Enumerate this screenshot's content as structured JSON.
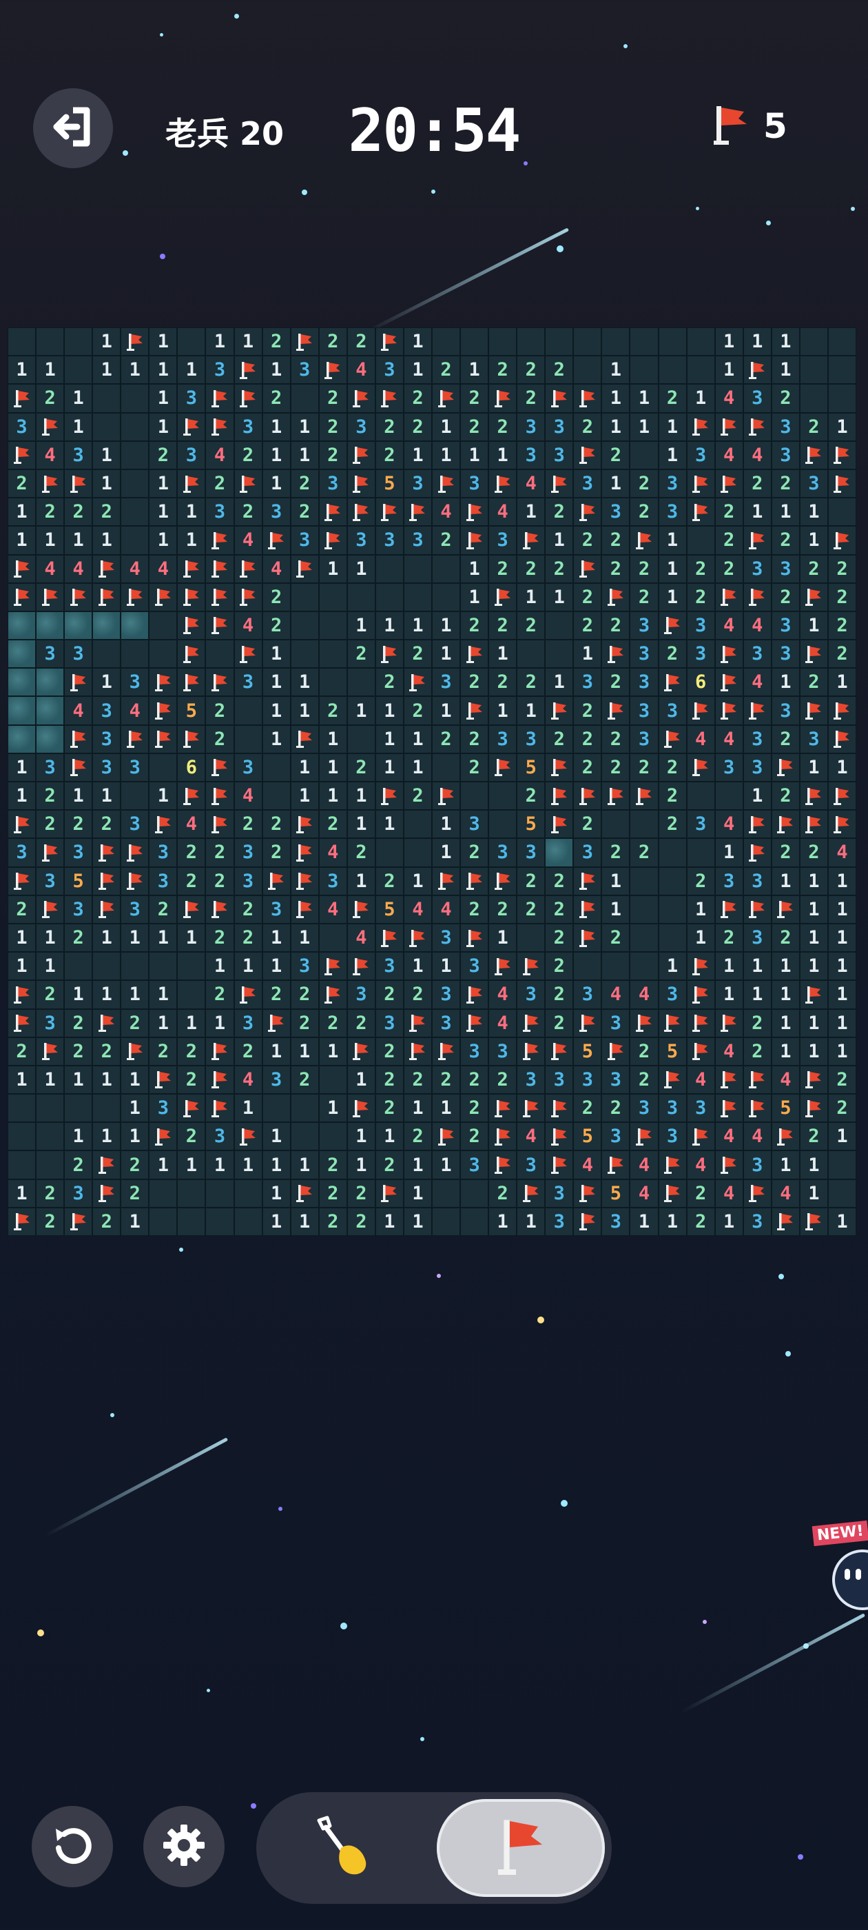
{
  "header": {
    "level_label": "老兵 20",
    "timer": "20:54",
    "flags_remaining": "5",
    "exit_icon": "exit-icon",
    "flag_icon": "flag-icon"
  },
  "board": {
    "columns": 30,
    "rows": 32,
    "legend": {
      "F": "flag",
      "X": "unrevealed",
      ".": "empty",
      "1-6": "adjacent mine count"
    },
    "cells": [
      "...1F1.112F22F1..........111..",
      "11.11113F13F43121222.1...1F1..",
      "F21..13FF2.2FF2F2F2FF1121432..",
      "3F1..1FF3112322122332111FFF321",
      "F431.2342112F2111133F2.13443FF1",
      "2FF1.1F2F123F53F3F4F3123FF223FF21",
      "1222.113232FFFF4F412F323F2111",
      "1111.11F4F3F3332F3F122F1.2F21F1",
      "F44F44FFF4F11...1222F2212233221",
      "FFFFFFFFF2......1F112F212FF2F211",
      "XXXXX.FF42..1111222.223F3443122",
      "X33...F.F1..2F21F1..1F323F33F2F1",
      "XXF13FFF311..2F32221323F6F4121",
      "XX434F52.1121121F11F2F33FFF3FF",
      "XXF3FFF2.1F1.1122332223F44323F2",
      "13F33.6F3.11211.2F5F2222F33F111",
      "1211.1FF4.111F2F..2FFFF2..12FFFF",
      "F2223F4F22F211.13.5F2..234FFFF1",
      "3F3FF32232F42..1233X322..1F224331",
      "F35FF3223FF3121FFF22F1..233111F4F",
      "2F3F32FF23F4F5442222F1..1FFF112FF",
      "11211112211.4FF3F1.2F2..12321122",
      "11.....1113FF3113FF2...1F1111111",
      "F21111.2F22F3223F4323443F111F1",
      "F32F21113F2223F3F4F2F3FFFF21111",
      "2F22F22F2111F2FF33FF5F25F4211111",
      "11111F2F432.12222233332F4FF4F2F1",
      "....13FF1..1F2112FFF22333FF5F21122",
      "..111F23F1..112F2F4F53F3F44F21..1F",
      "..2F2111111212113F3F4F4F4F311..11",
      "123F2....1F22F1..2F3F54F24F41...",
      "F2F21....112211..113F311213FF1..."
    ]
  },
  "controls": {
    "undo_icon": "undo-icon",
    "settings_icon": "gear-icon",
    "dig_icon": "shovel-icon",
    "flag_mode_icon": "flag-icon",
    "active_mode": "flag"
  },
  "badge": {
    "new_label": "NEW!"
  }
}
